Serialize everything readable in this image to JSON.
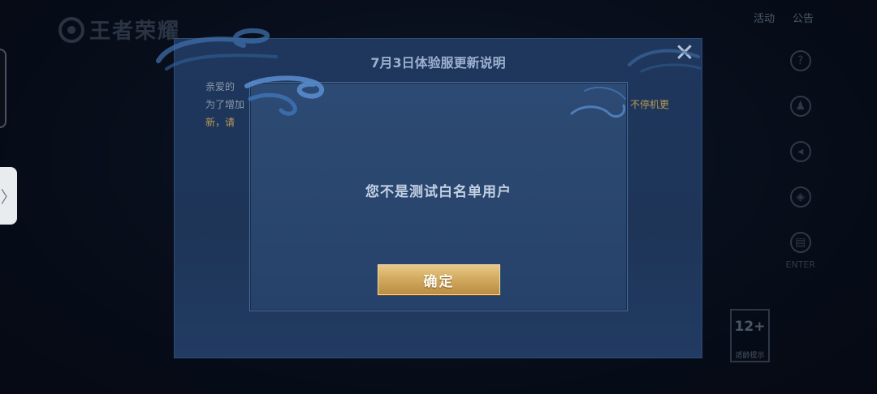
{
  "background": {
    "logo_text": "王者荣耀",
    "top_right": [
      "活动",
      "公告"
    ],
    "side_items": [
      {
        "icon": "question-icon",
        "glyph": "?"
      },
      {
        "icon": "person-icon",
        "glyph": "♟"
      },
      {
        "icon": "speaker-icon",
        "glyph": "◂"
      },
      {
        "icon": "shield-icon",
        "glyph": "◈"
      },
      {
        "icon": "document-icon",
        "glyph": "▤"
      }
    ],
    "side_label": "ENTER",
    "age_rating": "12+",
    "age_rating_sub": "适龄提示",
    "handle_glyph": "〉"
  },
  "update_notice": {
    "title": "7月3日体验服更新说明",
    "close_glyph": "✕",
    "line1": "亲爱的",
    "line2": "为了增加",
    "line3_start": "新，请",
    "right_text": "不停机更"
  },
  "dialog": {
    "message": "您不是测试白名单用户",
    "confirm_label": "确定"
  },
  "colors": {
    "dialog_bg": "#2a476f",
    "dialog_border": "#4a6d9e",
    "button_gold": "#d3ab60",
    "notice_highlight": "#b89a57"
  }
}
